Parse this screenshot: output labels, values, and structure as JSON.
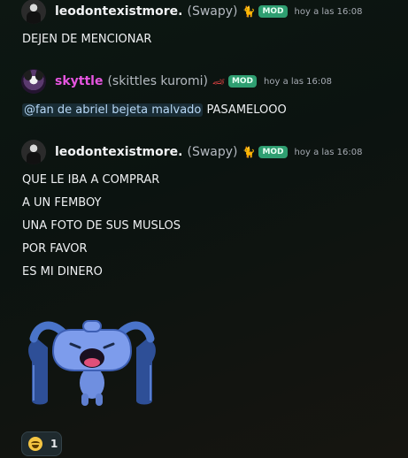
{
  "messages": [
    {
      "username": "leodontexistmore.",
      "nickname": "(Swapy)",
      "deco_icon": "cat-icon",
      "badge": "MOD",
      "time": "hoy a las 16:08",
      "lines": [
        "DEJEN DE MENCIONAR"
      ]
    },
    {
      "username": "skyttle",
      "nickname": "(skittles kuromi)",
      "deco_icon": "race-car-icon",
      "badge": "MOD",
      "time": "hoy a las 16:08",
      "mention": "@fan de abriel bejeta malvado",
      "text": "PASAMELOOO",
      "name_color": "#e655e0"
    },
    {
      "username": "leodontexistmore.",
      "nickname": "(Swapy)",
      "deco_icon": "cat-icon",
      "badge": "MOD",
      "time": "hoy a las 16:08",
      "lines": [
        "QUE LE IBA A COMPRAR",
        "A UN FEMBOY",
        "UNA FOTO DE SUS MUSLOS",
        "POR FAVOR",
        "ES MI DINERO"
      ],
      "sticker": "crying-discord-mascot-sticker",
      "reaction": {
        "emoji": "grinning-face-icon",
        "count": "1"
      }
    }
  ]
}
